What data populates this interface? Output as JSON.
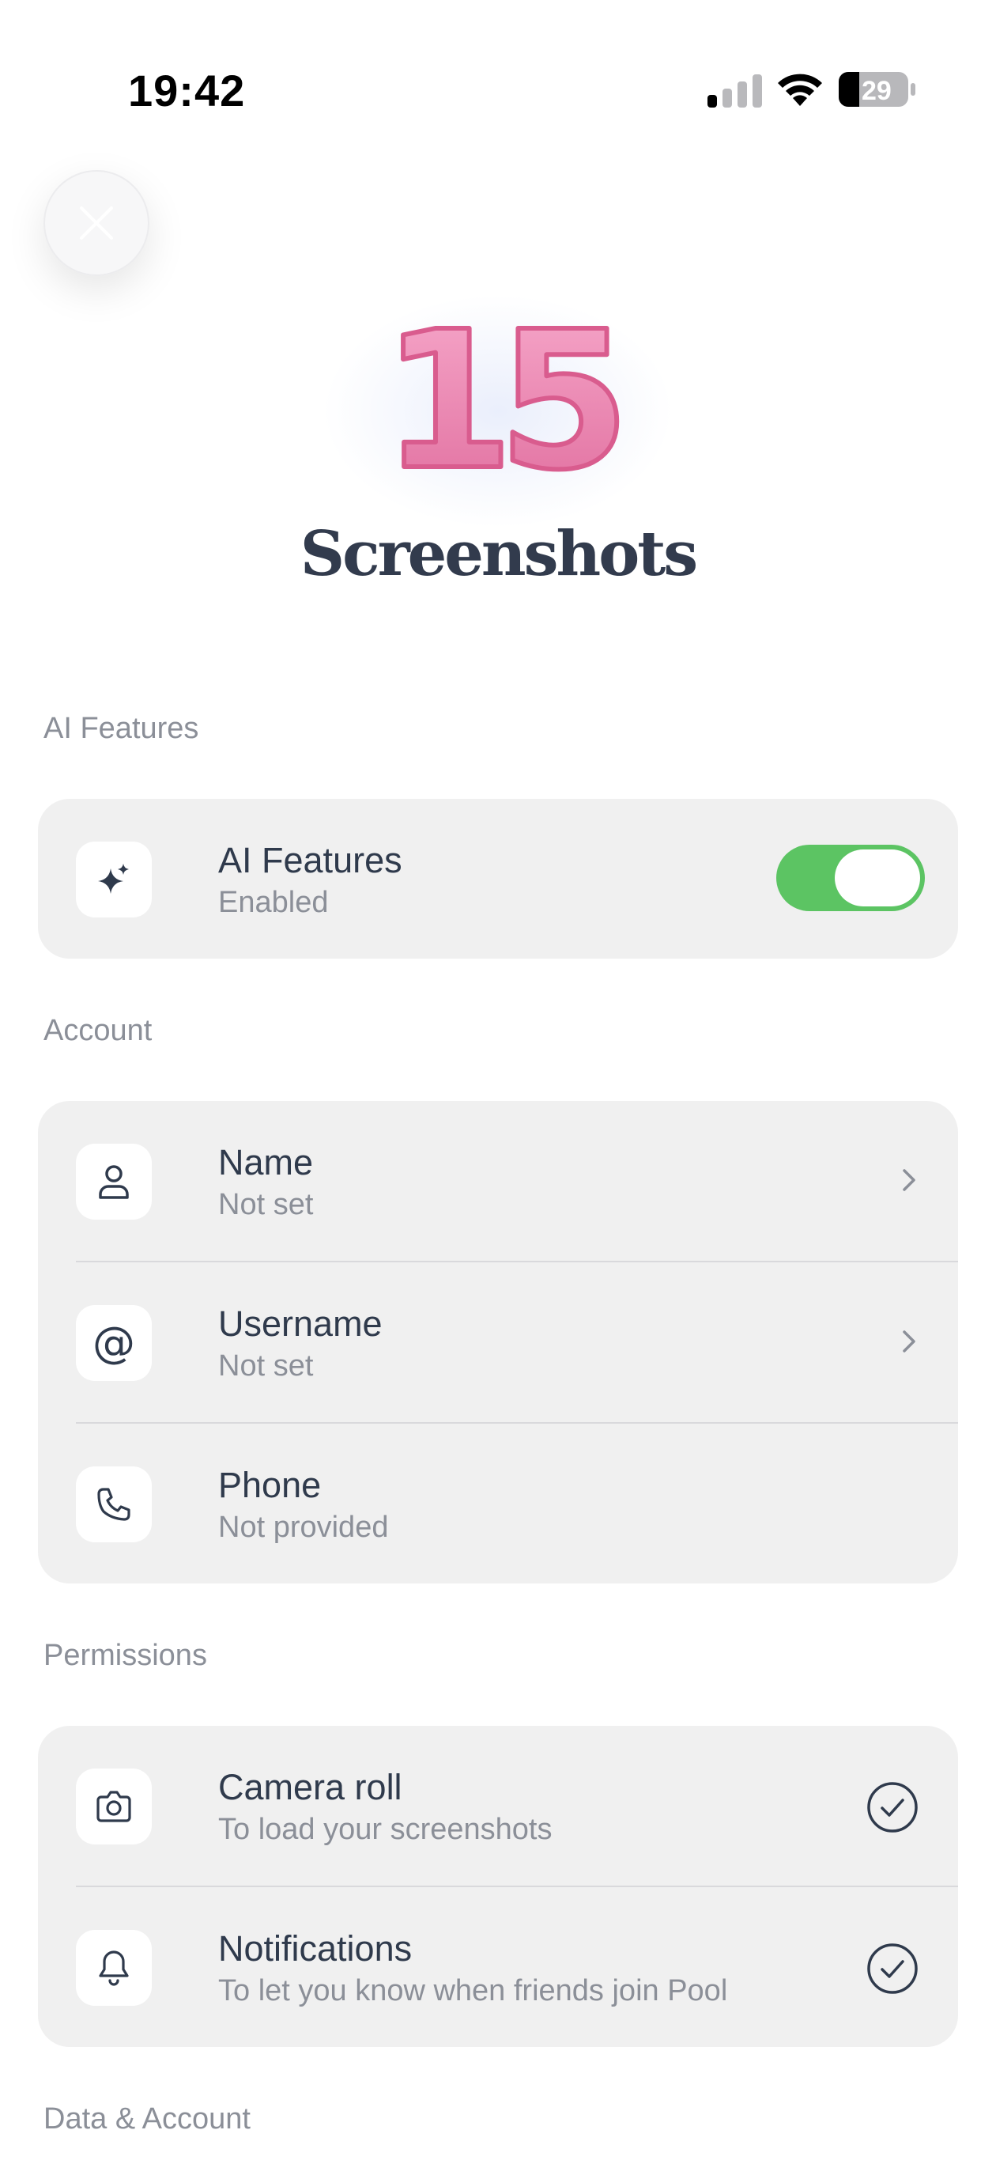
{
  "status_bar": {
    "time": "19:42",
    "battery_level": "29"
  },
  "header": {
    "app_title": "Screenshots",
    "count_badge": "15"
  },
  "sections": {
    "ai": {
      "label": "AI Features",
      "row": {
        "title": "AI Features",
        "subtitle": "Enabled",
        "toggle_on": true
      }
    },
    "account": {
      "label": "Account",
      "rows": [
        {
          "title": "Name",
          "subtitle": "Not set"
        },
        {
          "title": "Username",
          "subtitle": "Not set"
        },
        {
          "title": "Phone",
          "subtitle": "Not provided"
        }
      ]
    },
    "permissions": {
      "label": "Permissions",
      "rows": [
        {
          "title": "Camera roll",
          "subtitle": "To load your screenshots"
        },
        {
          "title": "Notifications",
          "subtitle": "To let you know when friends join Pool"
        }
      ]
    },
    "data_account": {
      "label": "Data & Account"
    }
  },
  "colors": {
    "toggle_on": "#5cc463",
    "card_bg": "#f0f0f0",
    "hero_pink": "#ee8fb6"
  },
  "icons": [
    "close-icon",
    "sparkle-icon",
    "person-icon",
    "at-icon",
    "phone-icon",
    "camera-icon",
    "bell-icon",
    "chevron-right-icon",
    "check-circle-icon"
  ]
}
